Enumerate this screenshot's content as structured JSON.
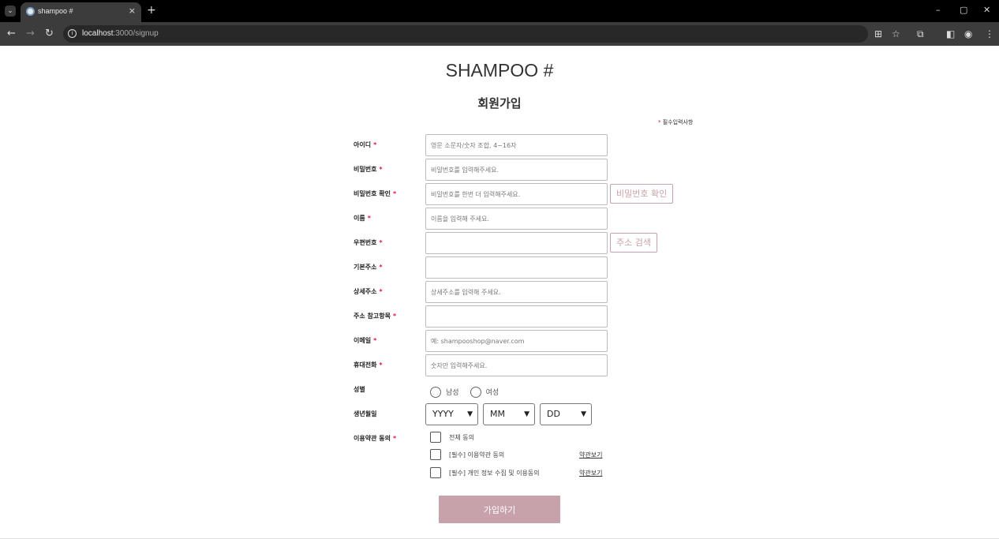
{
  "browser": {
    "tab_title": "shampoo #",
    "url_host": "localhost",
    "url_rest": ":3000/signup",
    "new_tab": "+",
    "tab_close": "×",
    "minimize": "–",
    "restore": "▢",
    "close": "✕"
  },
  "page": {
    "brand": "SHAMPOO #",
    "title": "회원가입",
    "required_star": "*",
    "required_note": "필수입력사항"
  },
  "form": {
    "id": {
      "label": "아이디",
      "placeholder": "영문 소문자/숫자 조합, 4~16자"
    },
    "password": {
      "label": "비밀번호",
      "placeholder": "비밀번호를 입력해주세요."
    },
    "password_confirm": {
      "label": "비밀번호 확인",
      "placeholder": "비밀번호를 한번 더 입력해주세요.",
      "button": "비밀번호 확인"
    },
    "name": {
      "label": "이름",
      "placeholder": "이름을 입력해 주세요."
    },
    "postcode": {
      "label": "우편번호",
      "placeholder": "",
      "button": "주소 검색"
    },
    "address": {
      "label": "기본주소",
      "placeholder": ""
    },
    "address_detail": {
      "label": "상세주소",
      "placeholder": "상세주소를 입력해 주세요."
    },
    "address_extra": {
      "label": "주소 참고항목",
      "placeholder": ""
    },
    "email": {
      "label": "이메일",
      "placeholder": "예: shampooshop@naver.com"
    },
    "phone": {
      "label": "휴대전화",
      "placeholder": "숫자만 입력해주세요."
    },
    "gender": {
      "label": "성별",
      "options": [
        "남성",
        "여성"
      ]
    },
    "birth": {
      "label": "생년월일",
      "year": "YYYY",
      "month": "MM",
      "day": "DD"
    },
    "terms": {
      "label": "이용약관 동의",
      "all": "전체 동의",
      "service": "[필수] 이용약관 동의",
      "privacy": "[필수] 개인 정보 수집 및 이용동의",
      "view_link": "약관보기"
    },
    "submit": "가입하기"
  }
}
